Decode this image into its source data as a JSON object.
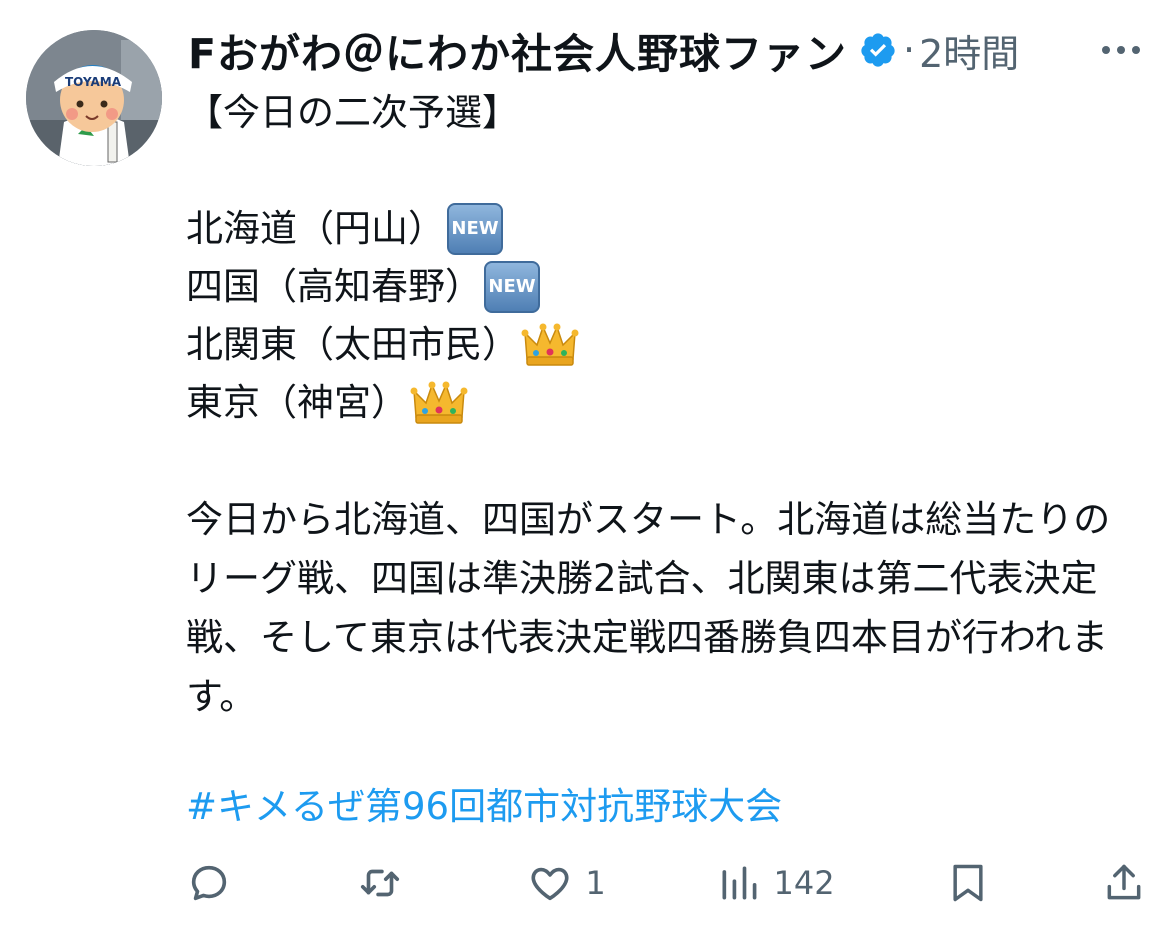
{
  "user": {
    "display_name": "Fおがわ＠にわか社会人野球ファン",
    "timestamp": "2時間",
    "separator": "·",
    "avatar_text": "TOYAMA"
  },
  "tweet": {
    "heading": "【今日の二次予選】",
    "lines": [
      {
        "text": "北海道（円山）",
        "emoji": "new"
      },
      {
        "text": "四国（高知春野）",
        "emoji": "new"
      },
      {
        "text": "北関東（太田市民）",
        "emoji": "crown"
      },
      {
        "text": "東京（神宮）",
        "emoji": "crown"
      }
    ],
    "emoji_new_label": "NEW",
    "paragraph": "今日から北海道、四国がスタート。北海道は総当たりのリーグ戦、四国は準決勝2試合、北関東は第二代表決定戦、そして東京は代表決定戦四番勝負四本目が行われます。",
    "hashtag": "#キメるぜ第96回都市対抗野球大会"
  },
  "actions": {
    "reply_count": "",
    "repost_count": "",
    "like_count": "1",
    "view_count": "142"
  },
  "colors": {
    "text": "#0f1419",
    "secondary": "#536471",
    "accent": "#1d9bf0"
  }
}
